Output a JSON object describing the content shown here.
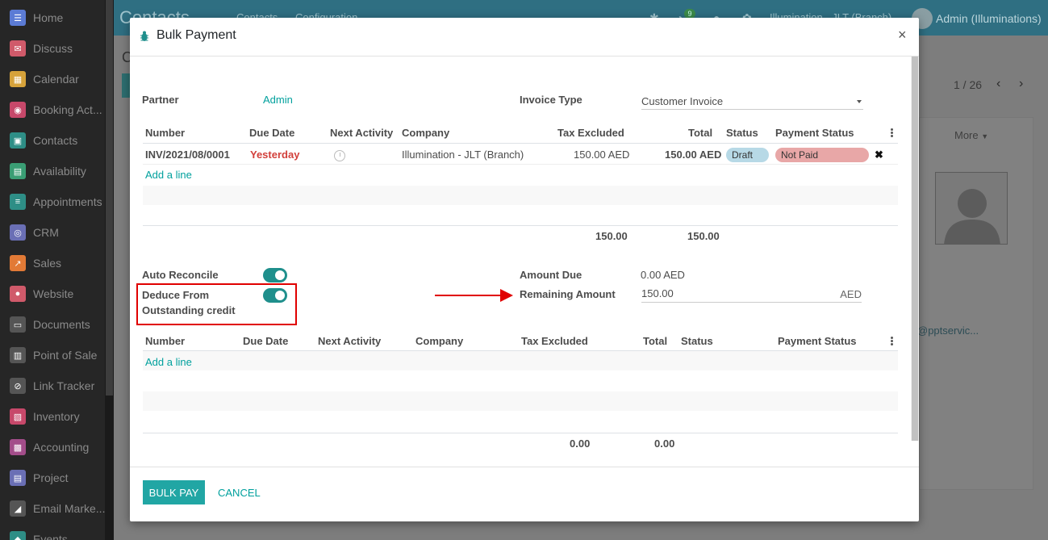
{
  "sidebar": {
    "items": [
      {
        "label": "Home",
        "color": "#5b7bd5"
      },
      {
        "label": "Discuss",
        "color": "#d05a6a"
      },
      {
        "label": "Calendar",
        "color": "#d6a23a"
      },
      {
        "label": "Booking Act...",
        "color": "#c7486a"
      },
      {
        "label": "Contacts",
        "color": "#2e8e86"
      },
      {
        "label": "Availability",
        "color": "#3a9e74"
      },
      {
        "label": "Appointments",
        "color": "#2e8e86"
      },
      {
        "label": "CRM",
        "color": "#6a6fb5"
      },
      {
        "label": "Sales",
        "color": "#e27a36"
      },
      {
        "label": "Website",
        "color": "#d05a6a"
      },
      {
        "label": "Documents",
        "color": "#555"
      },
      {
        "label": "Point of Sale",
        "color": "#555"
      },
      {
        "label": "Link Tracker",
        "color": "#555"
      },
      {
        "label": "Inventory",
        "color": "#c7486a"
      },
      {
        "label": "Accounting",
        "color": "#a34d8a"
      },
      {
        "label": "Project",
        "color": "#6a6fb5"
      },
      {
        "label": "Email Marke...",
        "color": "#555"
      },
      {
        "label": "Events",
        "color": "#2e8e86"
      }
    ]
  },
  "background": {
    "app_title": "Contacts",
    "nav": [
      "Contacts",
      "Configuration"
    ],
    "notification_count": "9",
    "company": "Illumination - JLT (Branch)",
    "user": "Admin (Illuminations)",
    "pager": "1 / 26",
    "more_label": "More",
    "email_fragment": "@pptservic...",
    "left_letter": "C"
  },
  "modal": {
    "title": "Bulk Payment",
    "partner_label": "Partner",
    "partner_value": "Admin",
    "invoice_type_label": "Invoice Type",
    "invoice_type_value": "Customer Invoice",
    "table1": {
      "headers": [
        "Number",
        "Due Date",
        "Next Activity",
        "Company",
        "Tax Excluded",
        "Total",
        "Status",
        "Payment Status"
      ],
      "row": {
        "number": "INV/2021/08/0001",
        "due_date": "Yesterday",
        "company": "Illumination - JLT (Branch)",
        "tax_excluded": "150.00 AED",
        "total": "150.00 AED",
        "status": "Draft",
        "payment_status": "Not Paid"
      },
      "add_line": "Add a line",
      "sum_tax_excluded": "150.00",
      "sum_total": "150.00"
    },
    "auto_reconcile_label": "Auto Reconcile",
    "deduce_label_1": "Deduce From",
    "deduce_label_2": "Outstanding credit",
    "amount_due_label": "Amount Due",
    "amount_due_value": "0.00 AED",
    "remaining_label": "Remaining Amount",
    "remaining_value": "150.00",
    "remaining_unit": "AED",
    "table2": {
      "headers": [
        "Number",
        "Due Date",
        "Next Activity",
        "Company",
        "Tax Excluded",
        "Total",
        "Status",
        "Payment Status"
      ],
      "add_line": "Add a line",
      "sum_tax_excluded": "0.00",
      "sum_total": "0.00"
    },
    "bulk_pay_label": "BULK PAY",
    "cancel_label": "CANCEL",
    "close_symbol": "×"
  },
  "colors": {
    "accent": "#00a09d",
    "primary_button": "#21a6a4",
    "highlight": "#e00000"
  }
}
